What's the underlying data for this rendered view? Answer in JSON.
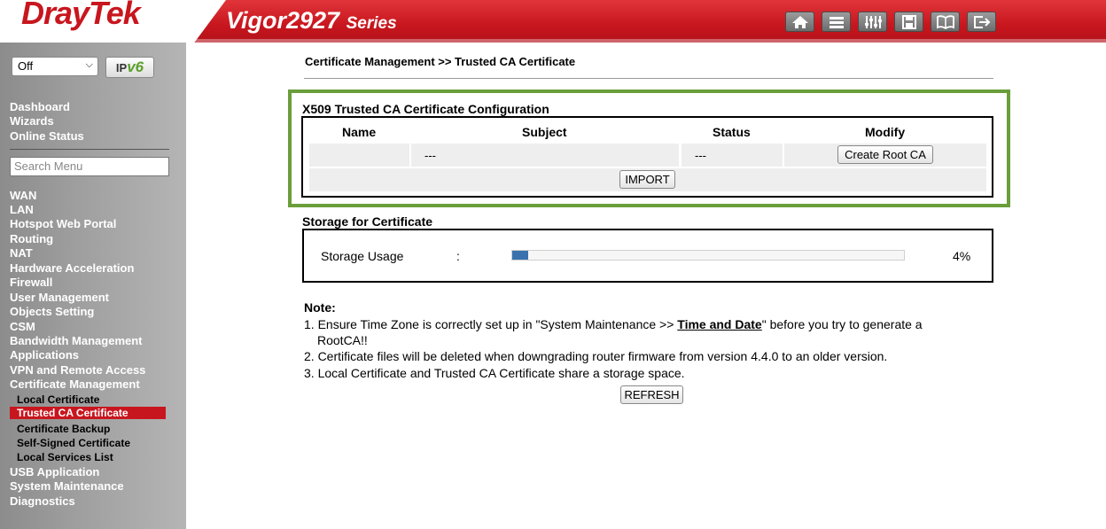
{
  "header": {
    "brand": "DrayTek",
    "model": "Vigor2927",
    "series": "Series",
    "tools": [
      {
        "icon": "home-icon"
      },
      {
        "icon": "quick-start-icon"
      },
      {
        "icon": "equalizer-icon"
      },
      {
        "icon": "save-icon"
      },
      {
        "icon": "book-icon"
      },
      {
        "icon": "logout-icon"
      }
    ]
  },
  "sidebar": {
    "mode_select": "Off",
    "ipv6_prefix": "IP",
    "ipv6_suffix": "v6",
    "search_placeholder": "Search Menu",
    "top_items": [
      "Dashboard",
      "Wizards",
      "Online Status"
    ],
    "items": [
      "WAN",
      "LAN",
      "Hotspot Web Portal",
      "Routing",
      "NAT",
      "Hardware Acceleration",
      "Firewall",
      "User Management",
      "Objects Setting",
      "CSM",
      "Bandwidth Management",
      "Applications",
      "VPN and Remote Access",
      "Certificate Management"
    ],
    "sub_items": [
      "Local Certificate",
      "Trusted CA Certificate",
      "Certificate Backup",
      "Self-Signed Certificate",
      "Local Services List"
    ],
    "bottom_items": [
      "USB Application",
      "System Maintenance",
      "Diagnostics"
    ]
  },
  "main": {
    "breadcrumb": "Certificate Management >> Trusted CA Certificate",
    "x509": {
      "title": "X509 Trusted CA Certificate Configuration",
      "columns": [
        "Name",
        "Subject",
        "Status",
        "Modify"
      ],
      "row": {
        "name": "",
        "subject": "---",
        "status": "---",
        "modify": "Create Root CA"
      },
      "import_label": "IMPORT"
    },
    "storage": {
      "title": "Storage for Certificate",
      "label": "Storage Usage",
      "colon": ":",
      "percent_text": "4%",
      "usage_fraction": 0.04
    },
    "note": {
      "title": "Note:",
      "line1_prefix": "1. Ensure Time Zone is correctly set up in \"System Maintenance >> ",
      "line1_link": "Time and Date",
      "line1_suffix": "\" before you try to generate a",
      "line1_cont": "RootCA!!",
      "line2": "2. Certificate files will be deleted when downgrading router firmware from version 4.4.0 to an older version.",
      "line3": "3. Local Certificate and Trusted CA Certificate share a storage space."
    },
    "refresh_label": "REFRESH"
  },
  "colors": {
    "brand_red": "#c8161e",
    "highlight_green": "#6a9e3a",
    "progress_blue": "#3a72b0"
  }
}
